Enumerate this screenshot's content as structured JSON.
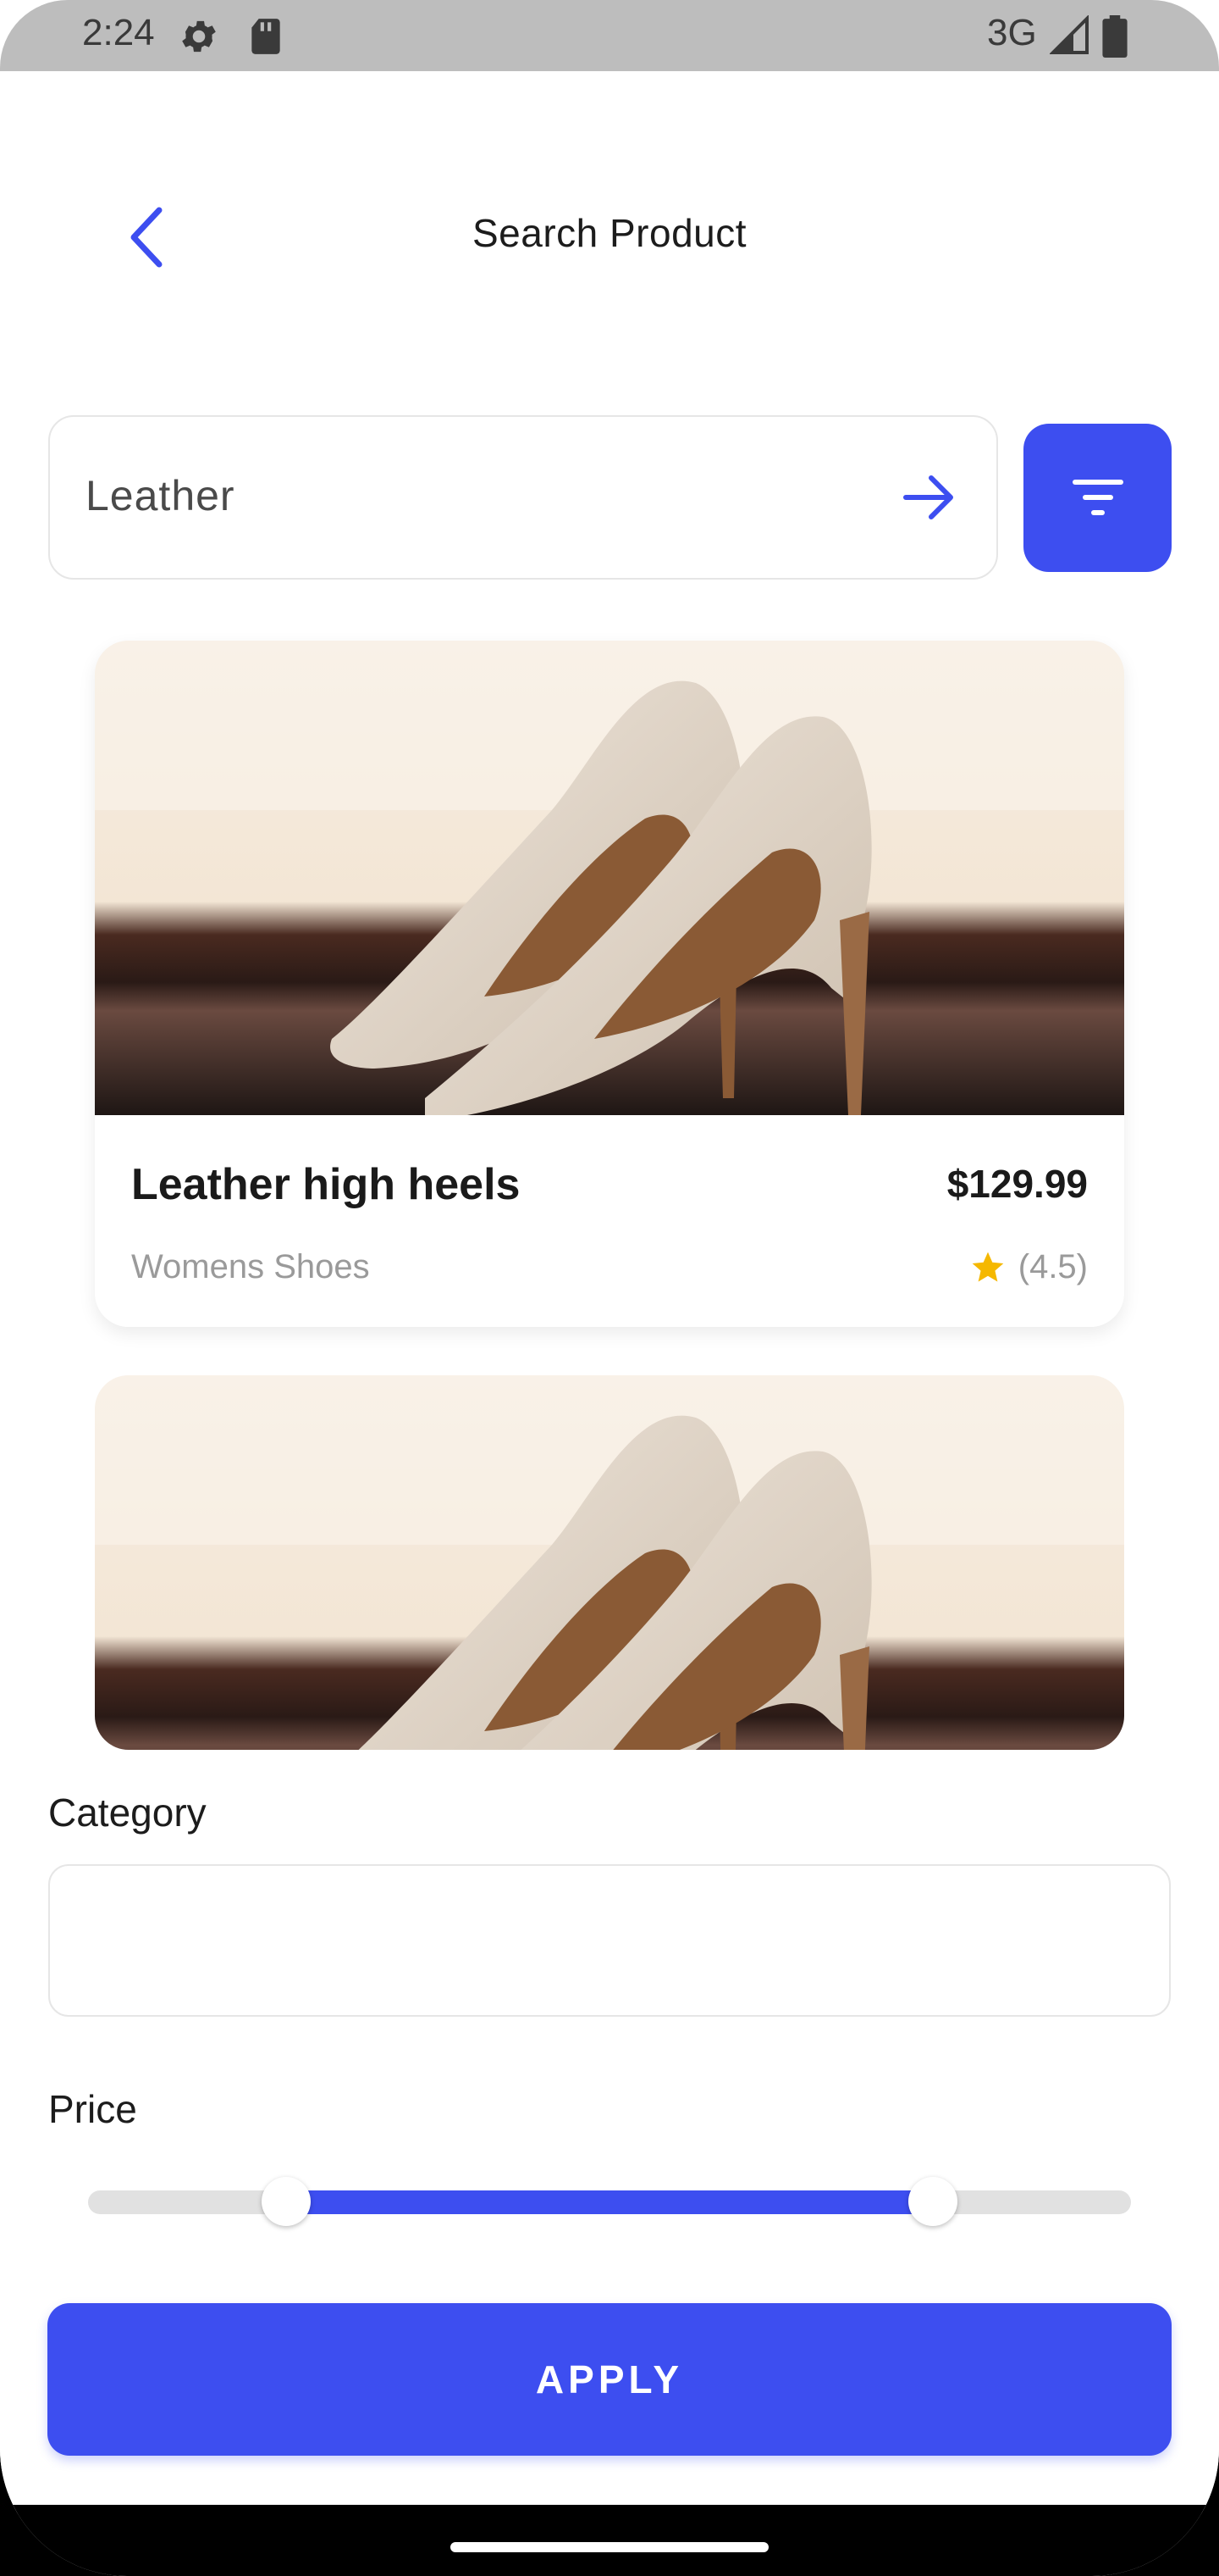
{
  "status_bar": {
    "time": "2:24",
    "network": "3G",
    "icons": [
      "settings-gear-icon",
      "sd-card-icon",
      "signal-icon",
      "battery-icon"
    ]
  },
  "header": {
    "title": "Search Product",
    "back_icon": "chevron-left-icon"
  },
  "search": {
    "value": "Leather",
    "submit_icon": "arrow-right-icon",
    "filter_icon": "filter-icon"
  },
  "products": [
    {
      "title": "Leather high heels",
      "price": "$129.99",
      "category": "Womens Shoes",
      "rating": "(4.5)",
      "image": "beige leather high heel shoes"
    },
    {
      "image": "beige leather high heel shoes"
    }
  ],
  "filter": {
    "category_label": "Category",
    "category_value": "",
    "price_label": "Price",
    "price_range": {
      "min": 0.19,
      "max": 0.81
    },
    "apply_label": "APPLY"
  },
  "colors": {
    "accent": "#3d4ef0",
    "star": "#f5b800",
    "muted_text": "#9a9a9a"
  }
}
